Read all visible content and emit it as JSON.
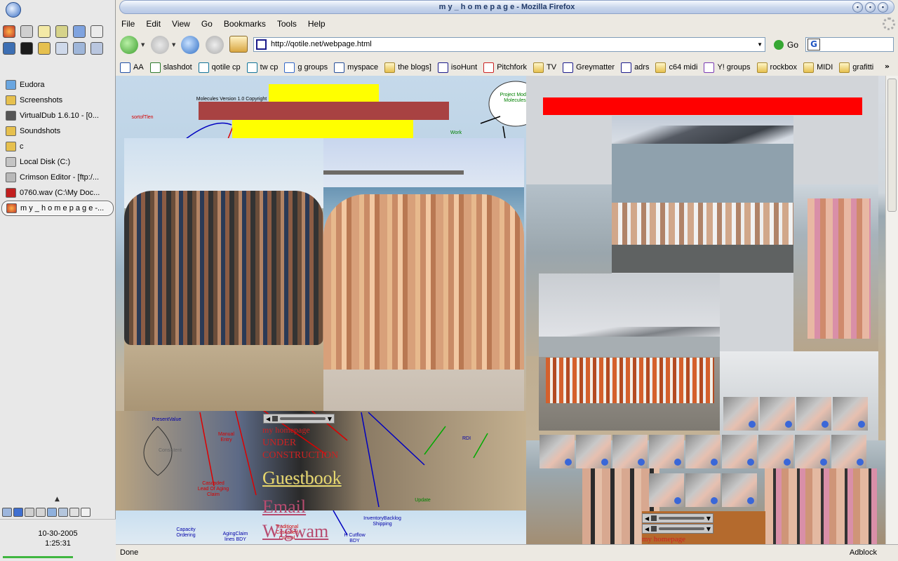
{
  "taskbar": {
    "tasks": [
      {
        "label": "Eudora",
        "icon": "eudora-icon"
      },
      {
        "label": "Screenshots",
        "icon": "folder-icon"
      },
      {
        "label": "VirtualDub 1.6.10 - [0...",
        "icon": "virtualdub-icon"
      },
      {
        "label": "Soundshots",
        "icon": "folder-icon"
      },
      {
        "label": "c",
        "icon": "folder-icon"
      },
      {
        "label": "Local Disk (C:)",
        "icon": "drive-icon"
      },
      {
        "label": "Crimson Editor - [ftp:/...",
        "icon": "crimson-editor-icon"
      },
      {
        "label": "0760.wav (C:\\My Doc...",
        "icon": "audio-editor-icon"
      },
      {
        "label": "m y _ h o m e p a g e -...",
        "icon": "firefox-icon",
        "active": true
      }
    ],
    "clock": {
      "date": "10-30-2005",
      "time": "1:25:31"
    }
  },
  "browser": {
    "title": "m y _ h o m e p a g e - Mozilla Firefox",
    "menus": [
      "File",
      "Edit",
      "View",
      "Go",
      "Bookmarks",
      "Tools",
      "Help"
    ],
    "url": "http://qotile.net/webpage.html",
    "go_label": "Go",
    "search_value": "",
    "bookmarks": [
      {
        "label": "AA",
        "icon": "site"
      },
      {
        "label": "slashdot",
        "icon": "site"
      },
      {
        "label": "qotile cp",
        "icon": "site"
      },
      {
        "label": "tw cp",
        "icon": "site"
      },
      {
        "label": "g groups",
        "icon": "site"
      },
      {
        "label": "myspace",
        "icon": "site"
      },
      {
        "label": "the blogs]",
        "icon": "folder"
      },
      {
        "label": "isoHunt",
        "icon": "site"
      },
      {
        "label": "Pitchfork",
        "icon": "site"
      },
      {
        "label": "TV",
        "icon": "folder"
      },
      {
        "label": "Greymatter",
        "icon": "site"
      },
      {
        "label": "adrs",
        "icon": "site"
      },
      {
        "label": "c64 midi",
        "icon": "folder"
      },
      {
        "label": "Y! groups",
        "icon": "site"
      },
      {
        "label": "rockbox",
        "icon": "folder"
      },
      {
        "label": "MIDI",
        "icon": "folder"
      },
      {
        "label": "grafitti",
        "icon": "folder"
      }
    ],
    "more_label": "»",
    "status": "Done",
    "adblock": "Adblock"
  },
  "page": {
    "diagram_labels": {
      "title": "Molecules Version 1.0 Copyright",
      "project": "Project Model Molecules",
      "work": "Work",
      "sortoftlen": "sortofTlen",
      "presentvalue": "PresentValue",
      "consistent": "Consistent",
      "manual": "Manual Entry",
      "cascaded": "Cascaded Lead Of Aging Claim",
      "capacity": "Capacity Ordering",
      "agingclaim": "AgingClaim lines BDY",
      "traditional": "Traditional Cascaded Control",
      "cutflow": "H Cutflow BDY",
      "inventory": "InventoryBacklog Shipping",
      "rdi": "RDI",
      "update": "Update"
    },
    "my_homepage": "my homepage",
    "under_construction": "UNDER CONSTRUCTION",
    "guestbook": "Guestbook",
    "email": "Email",
    "wigwam": "Wigwam",
    "homepage_small": "my homepage"
  }
}
